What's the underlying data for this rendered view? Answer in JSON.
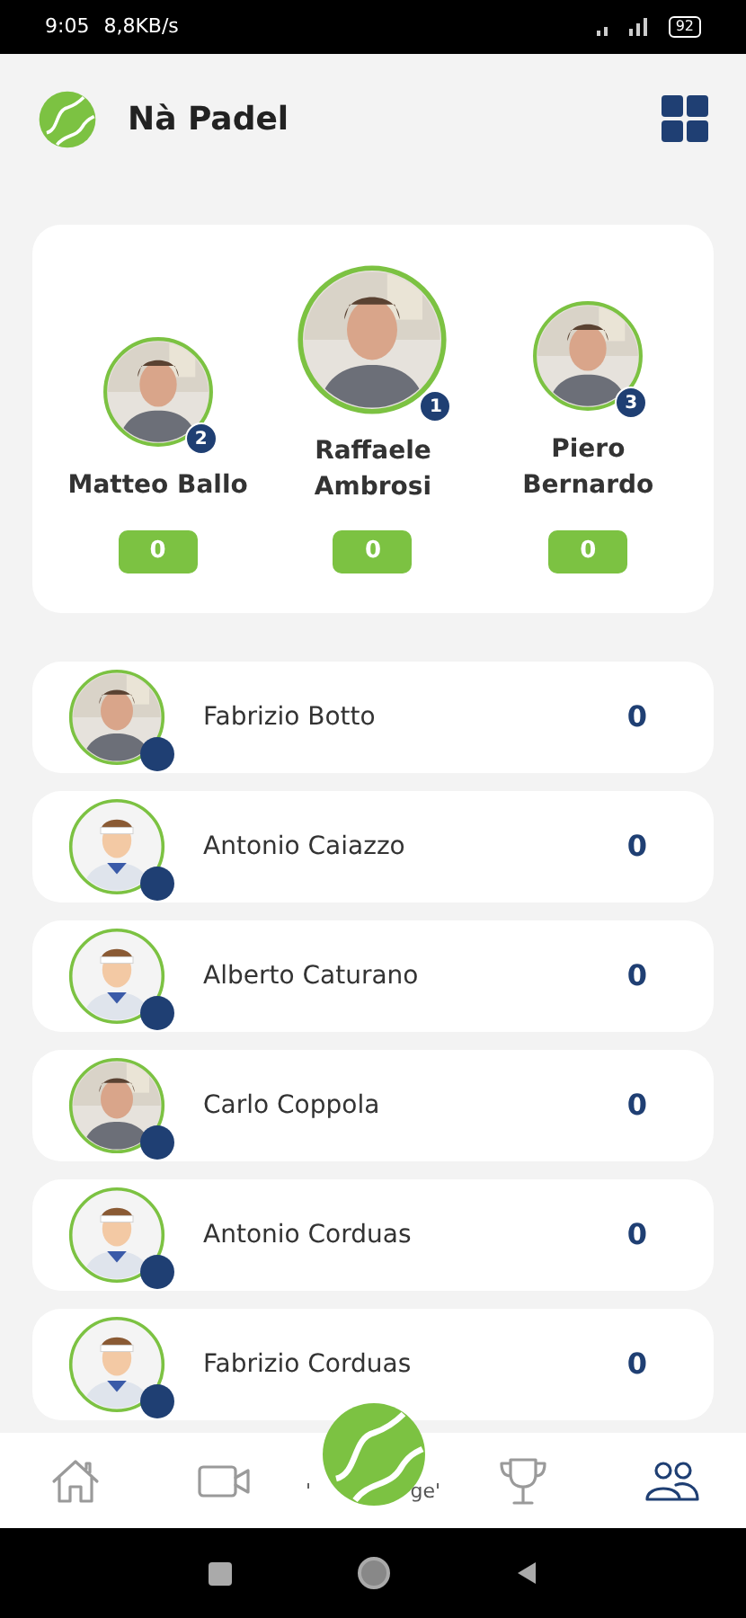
{
  "status_bar": {
    "time": "9:05",
    "speed": "8,8KB/s",
    "battery": "92"
  },
  "header": {
    "title": "Nà Padel"
  },
  "podium": [
    {
      "name": "Matteo Ballo",
      "rank": "2",
      "score": "0",
      "kind": "second"
    },
    {
      "name": "Raffaele Ambrosi",
      "rank": "1",
      "score": "0",
      "kind": "first"
    },
    {
      "name": "Piero Bernardo",
      "rank": "3",
      "score": "0",
      "kind": "third"
    }
  ],
  "players": [
    {
      "name": "Fabrizio Botto",
      "score": "0"
    },
    {
      "name": "Antonio Caiazzo",
      "score": "0",
      "kind": "default"
    },
    {
      "name": "Alberto Caturano",
      "score": "0",
      "kind": "default"
    },
    {
      "name": "Carlo Coppola",
      "score": "0"
    },
    {
      "name": "Antonio Corduas",
      "score": "0",
      "kind": "default"
    },
    {
      "name": "Fabrizio Corduas",
      "score": "0",
      "kind": "default"
    }
  ],
  "bottom_nav": {
    "items": [
      {
        "kind": "home",
        "selected": false
      },
      {
        "kind": "video",
        "selected": false
      },
      {
        "kind": "ball",
        "selected": false,
        "label_left": "'",
        "label_right": "ge'"
      },
      {
        "kind": "trophy",
        "selected": false
      },
      {
        "kind": "people",
        "selected": true
      }
    ]
  }
}
